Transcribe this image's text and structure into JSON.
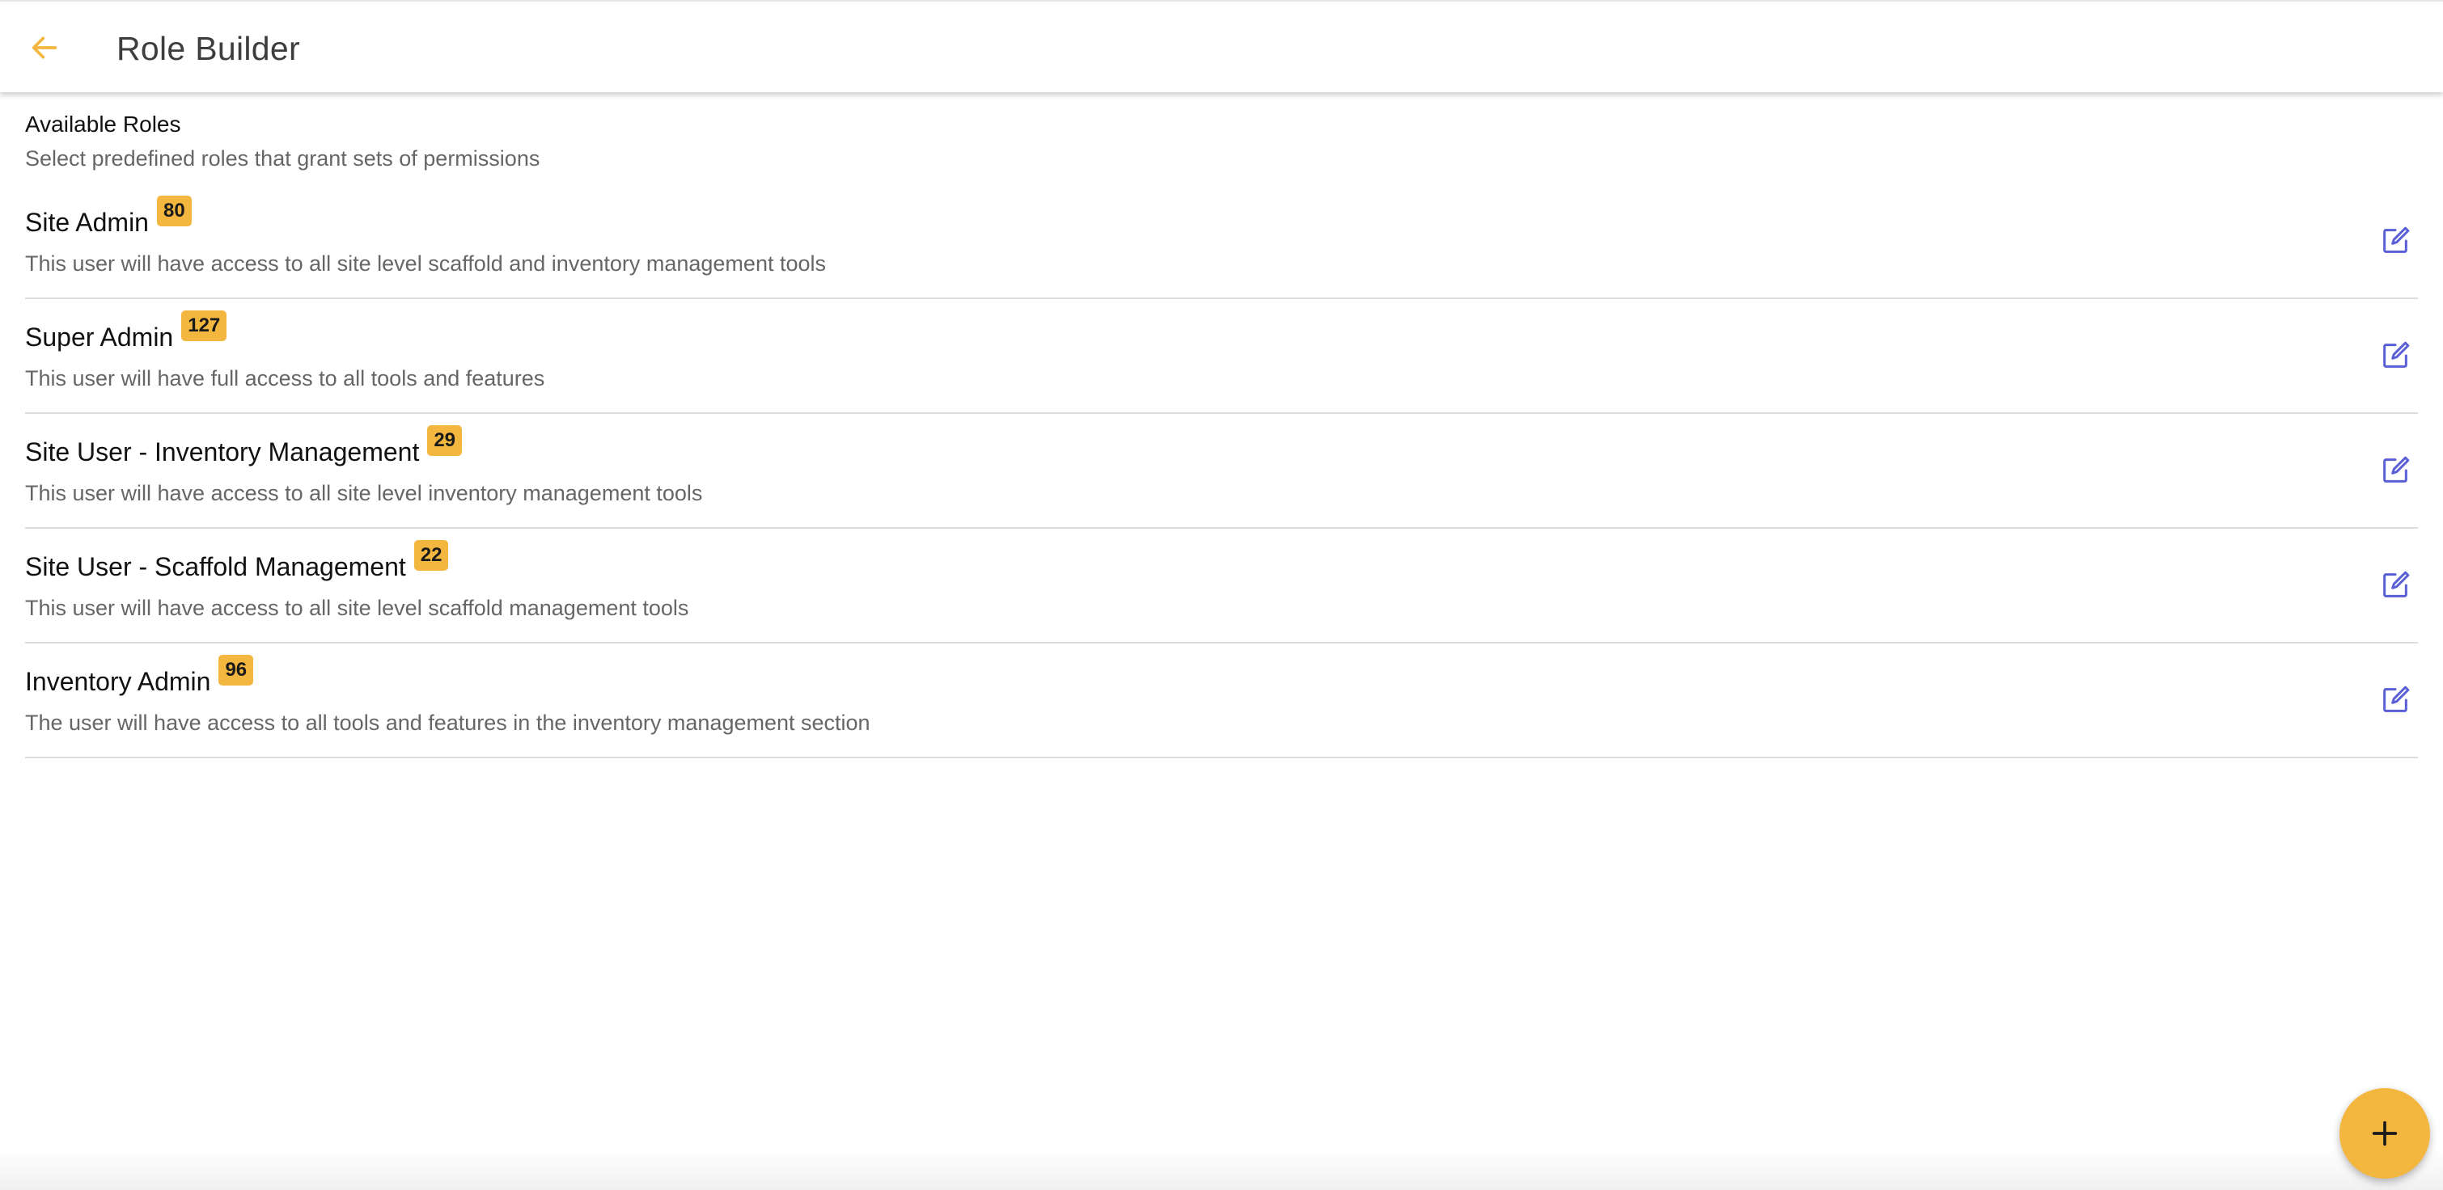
{
  "colors": {
    "accent": "#f3b73f",
    "edit_icon": "#5b5fd6",
    "title_text": "#3d3d3d",
    "secondary_text": "#666666",
    "divider": "#dcdcdc"
  },
  "header": {
    "title": "Role Builder",
    "back_icon": "arrow-left-icon"
  },
  "section": {
    "title": "Available Roles",
    "subtitle": "Select predefined roles that grant sets of permissions"
  },
  "roles": [
    {
      "name": "Site Admin",
      "count": "80",
      "description": "This user will have access to all site level scaffold and inventory management tools"
    },
    {
      "name": "Super Admin",
      "count": "127",
      "description": "This user will have full access to all tools and features"
    },
    {
      "name": "Site User - Inventory Management",
      "count": "29",
      "description": "This user will have access to all site level inventory management tools"
    },
    {
      "name": "Site User - Scaffold Management",
      "count": "22",
      "description": "This user will have access to all site level scaffold management tools"
    },
    {
      "name": "Inventory Admin",
      "count": "96",
      "description": "The user will have access to all tools and features in the inventory management section"
    }
  ],
  "row_action_icon": "edit-icon",
  "fab": {
    "icon": "plus-icon"
  }
}
